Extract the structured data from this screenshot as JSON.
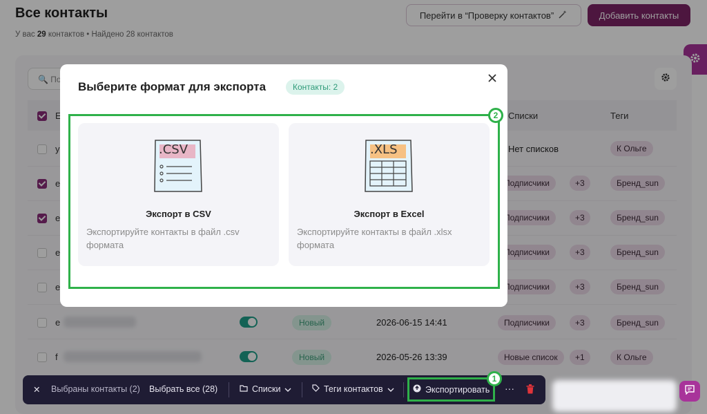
{
  "header": {
    "title": "Все контакты",
    "subtitle_prefix": "У вас ",
    "subtitle_count": "29",
    "subtitle_mid": " контактов • Найдено 28 контактов",
    "check_button": "Перейти в “Проверку контактов”",
    "add_button": "Добавить контакты"
  },
  "table": {
    "search_placeholder": "По",
    "columns": [
      "E",
      "Списки",
      "Теги"
    ],
    "rows": [
      {
        "email": "у",
        "checked": false,
        "lists": "Нет списков",
        "lists_more": "",
        "tag": "К Ольге"
      },
      {
        "email": "е",
        "checked": true,
        "lists": "Подписчики",
        "lists_more": "+3",
        "tag": "Бренд_sun"
      },
      {
        "email": "е",
        "checked": true,
        "lists": "Подписчики",
        "lists_more": "+3",
        "tag": "Бренд_sun"
      },
      {
        "email": "е",
        "checked": false,
        "lists": "Подписчики",
        "lists_more": "+3",
        "tag": "Бренд_sun"
      },
      {
        "email": "е",
        "checked": false,
        "lists": "Подписчики",
        "lists_more": "+3",
        "tag": "Бренд_sun"
      },
      {
        "email": "е",
        "checked": false,
        "status": "Новый",
        "date": "2026-06-15 14:41",
        "lists": "Подписчики",
        "lists_more": "+3",
        "tag": "Бренд_sun"
      },
      {
        "email": "f",
        "checked": false,
        "status": "Новый",
        "date": "2026-05-26 13:39",
        "lists": "Новые список",
        "lists_more": "+1",
        "tag": "К Ольге"
      }
    ]
  },
  "modal": {
    "title": "Выберите формат для экспорта",
    "badge": "Контакты: 2",
    "options": [
      {
        "file_label": ".CSV",
        "title": "Экспорт в CSV",
        "desc": "Экспортируйте контакты в файл .csv формата"
      },
      {
        "file_label": ".XLS",
        "title": "Экспорт в Excel",
        "desc": "Экспортируйте контакты в файл .xlsx формата"
      }
    ]
  },
  "bottom_bar": {
    "selected": "Выбраны контакты (2)",
    "select_all": "Выбрать все (28)",
    "lists": "Списки",
    "tags": "Теги контактов",
    "export": "Экспортировать",
    "more": "···"
  },
  "annotations": {
    "step1": "1",
    "step2": "2"
  },
  "colors": {
    "brand": "#7d2567",
    "accent": "#a8339a",
    "highlight": "#2fb14a",
    "bar": "#1f1c34"
  }
}
